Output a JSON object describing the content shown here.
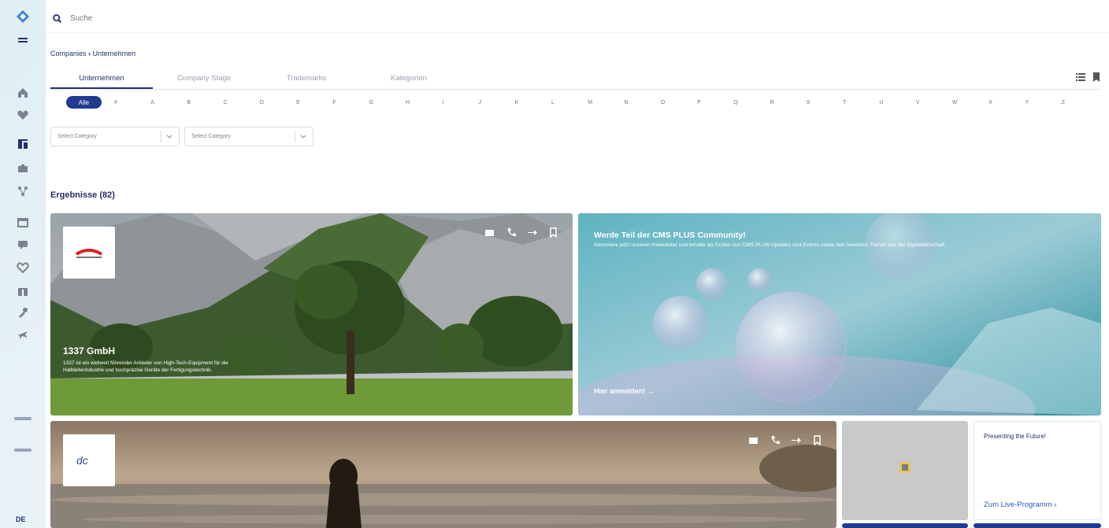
{
  "search": {
    "placeholder": "Suche"
  },
  "sidebar": {
    "language": "DE",
    "items": [
      {
        "icon": "home-icon"
      },
      {
        "icon": "heart-icon"
      },
      {
        "icon": "companies-icon",
        "active": true
      },
      {
        "icon": "briefcase-icon"
      },
      {
        "icon": "network-icon"
      },
      {
        "icon": "calendar-icon"
      },
      {
        "icon": "chat-icon"
      },
      {
        "icon": "handshake-icon"
      },
      {
        "icon": "gift-icon"
      },
      {
        "icon": "wrench-icon"
      },
      {
        "icon": "airplane-icon"
      }
    ]
  },
  "breadcrumb": {
    "root": "Companies",
    "separator": "›",
    "current": "Unternehmen"
  },
  "tabs": [
    {
      "label": "Unternehmen",
      "active": true
    },
    {
      "label": "Company Stage"
    },
    {
      "label": "Trademarks"
    },
    {
      "label": "Kategorien"
    }
  ],
  "alphabet": {
    "all_label": "Alle",
    "letters": [
      "#",
      "A",
      "B",
      "C",
      "D",
      "E",
      "F",
      "G",
      "H",
      "I",
      "J",
      "K",
      "L",
      "M",
      "N",
      "O",
      "P",
      "Q",
      "R",
      "S",
      "T",
      "U",
      "V",
      "W",
      "X",
      "Y",
      "Z"
    ]
  },
  "filters": [
    {
      "placeholder": "Select Category"
    },
    {
      "placeholder": "Select Category"
    }
  ],
  "results": {
    "label": "Ergebnisse (82)"
  },
  "cards": {
    "company1": {
      "title": "1337 GmbH",
      "description": "1337 ist ein weltweit führender Anbieter von High-Tech-Equipment für die Halbleiterindustrie und hochpräzise Geräte der Fertigungstechnik."
    },
    "promo": {
      "title": "Werde Teil der CMS PLUS Community!",
      "text": "Abonniere jetzt unseren Newsletter und erhalte als Erstes von CMS PLUS Updates und Events sowie den neuesten Trends aus der Digitalwirtschaft.",
      "cta": "Hier anmelden! →"
    },
    "small": {
      "title": "Presenting the Future!",
      "link": "Zum Live-Programm ›"
    }
  },
  "colors": {
    "primary": "#26306b",
    "accent": "#1f3a8f",
    "link": "#2b59c3"
  }
}
